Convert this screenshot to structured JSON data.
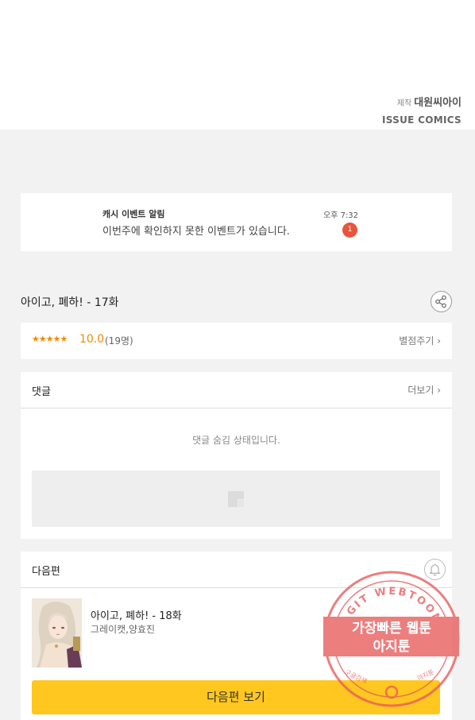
{
  "credits": {
    "production_prefix": "제작",
    "production_name": "대원씨아이",
    "publisher": "ISSUE COMICS"
  },
  "notice": {
    "title": "캐시 이벤트 알림",
    "message": "이번주에 확인하지 못한 이벤트가 있습니다.",
    "time": "오후 7:32",
    "badge": "1"
  },
  "episode": {
    "title": "아이고, 폐하! - 17화",
    "share_icon": "share-icon"
  },
  "rating": {
    "stars": "★★★★★",
    "score": "10.0",
    "count": "(19명)",
    "rate_label": "별점주기 ›",
    "star_color": "#f08a00"
  },
  "comments": {
    "title": "댓글",
    "more_label": "더보기 ›",
    "hidden_message": "댓글 숨김 상태입니다."
  },
  "next_episode": {
    "section_title": "다음편",
    "bell_icon": "bell-icon",
    "episode_title": "아이고, 폐하! - 18화",
    "authors": "그레이캣,양효진",
    "button_label": "다음편 보기",
    "button_color": "#ffc71f"
  },
  "watermark": {
    "arc_text": "AGIT WEBTOON",
    "line1": "가장빠른 웹툰",
    "line2": "아지툰",
    "bottom_left": "구글검색",
    "bottom_right": "아지툰",
    "color": "#e85a5a"
  }
}
